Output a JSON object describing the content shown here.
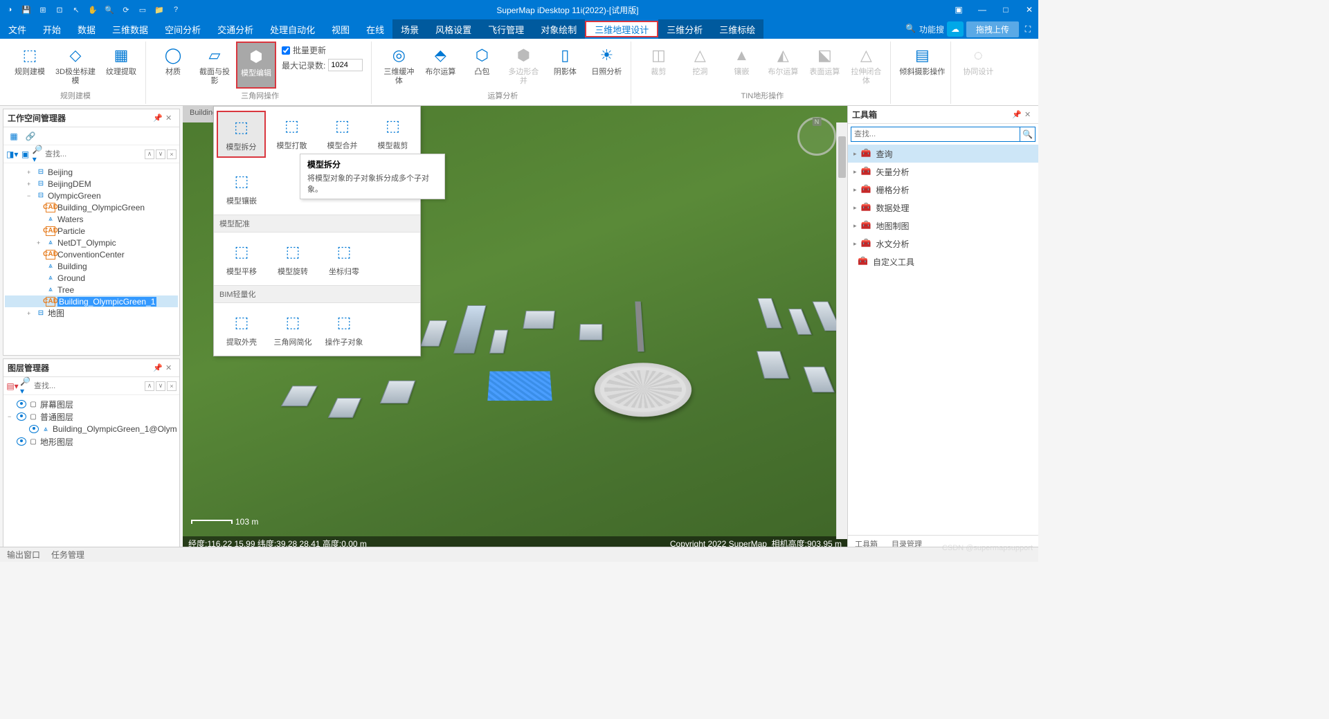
{
  "titlebar": {
    "title": "SuperMap iDesktop 11i(2022)-[试用版]"
  },
  "menu": {
    "items": [
      "文件",
      "开始",
      "数据",
      "三维数据",
      "空间分析",
      "交通分析",
      "处理自动化",
      "视图",
      "在线"
    ],
    "dark_items": [
      "场景",
      "风格设置",
      "飞行管理",
      "对象绘制"
    ],
    "active": "三维地理设计",
    "dark_items2": [
      "三维分析",
      "三维标绘"
    ],
    "search_kw": "功能搜",
    "upload": "拖拽上传"
  },
  "ribbon": {
    "g1": {
      "b1": "规则建模",
      "b2": "3D极坐标建模",
      "b3": "纹理提取",
      "lbl": "规则建模"
    },
    "g2": {
      "b1": "材质",
      "b2": "截面与投影",
      "b3": "模型编辑",
      "chk": "批量更新",
      "maxrec": "最大记录数:",
      "maxval": "1024",
      "lbl": "三角网操作"
    },
    "g3": {
      "b1": "三维缓冲体",
      "b2": "布尔运算",
      "b3": "凸包",
      "b4": "多边形合并",
      "b5": "阴影体",
      "b6": "日照分析",
      "lbl": "运算分析"
    },
    "g4": {
      "b1": "裁剪",
      "b2": "挖洞",
      "b3": "镶嵌",
      "b4": "布尔运算",
      "b5": "表面运算",
      "b6": "拉伸闭合体",
      "lbl": "TIN地形操作"
    },
    "g5": {
      "b1": "倾斜摄影操作"
    },
    "g6": {
      "b1": "协同设计"
    }
  },
  "workspace": {
    "title": "工作空间管理器",
    "search": "查找...",
    "tree": [
      {
        "d": 2,
        "tw": "+",
        "ico": "ds",
        "txt": "Beijing"
      },
      {
        "d": 2,
        "tw": "+",
        "ico": "ds",
        "txt": "BeijingDEM"
      },
      {
        "d": 2,
        "tw": "−",
        "ico": "ds",
        "txt": "OlympicGreen"
      },
      {
        "d": 3,
        "ico": "cad",
        "txt": "Building_OlympicGreen"
      },
      {
        "d": 3,
        "ico": "ln",
        "txt": "Waters"
      },
      {
        "d": 3,
        "ico": "cad",
        "txt": "Particle"
      },
      {
        "d": 3,
        "tw": "+",
        "ico": "ln",
        "txt": "NetDT_Olympic"
      },
      {
        "d": 3,
        "ico": "cad",
        "txt": "ConventionCenter"
      },
      {
        "d": 3,
        "ico": "ln",
        "txt": "Building"
      },
      {
        "d": 3,
        "ico": "ln",
        "txt": "Ground"
      },
      {
        "d": 3,
        "ico": "ln",
        "txt": "Tree"
      },
      {
        "d": 3,
        "ico": "cad",
        "txt": "Building_OlympicGreen_1",
        "sel": true
      },
      {
        "d": 2,
        "tw": "+",
        "ico": "ds",
        "txt": "地图"
      }
    ]
  },
  "layers": {
    "title": "图层管理器",
    "search": "查找...",
    "tree": [
      {
        "d": 0,
        "eye": true,
        "txt": "屏幕图层"
      },
      {
        "d": 0,
        "eye": true,
        "tw": "−",
        "txt": "普通图层"
      },
      {
        "d": 1,
        "eye": true,
        "ico": "ln",
        "txt": "Building_OlympicGreen_1@Olym"
      },
      {
        "d": 0,
        "eye": true,
        "txt": "地形图层"
      }
    ]
  },
  "dropdown": {
    "r1": [
      {
        "l": "模型拆分",
        "hl": true
      },
      {
        "l": "模型打散"
      },
      {
        "l": "模型合并"
      },
      {
        "l": "模型裁剪"
      }
    ],
    "r2": [
      {
        "l": "模型镶嵌"
      }
    ],
    "h2": "模型配准",
    "r3": [
      {
        "l": "模型平移"
      },
      {
        "l": "模型旋转"
      },
      {
        "l": "坐标归零"
      }
    ],
    "h3": "BIM轻量化",
    "r4": [
      {
        "l": "提取外壳"
      },
      {
        "l": "三角网简化"
      },
      {
        "l": "操作子对象"
      }
    ]
  },
  "tooltip": {
    "title": "模型拆分",
    "body": "将模型对象的子对象拆分成多个子对象。"
  },
  "tab": {
    "name": "Building_"
  },
  "viewport": {
    "scale": "103 m",
    "coords_left": "经度:116.22  15.99  纬度:39.28  28.41  高度:0.00 m",
    "coords_right": "相机高度:903.95 m",
    "copyright": "Copyright 2022 SuperMap"
  },
  "toolbox": {
    "title": "工具箱",
    "search": "查找...",
    "items": [
      {
        "l": "查询",
        "active": true
      },
      {
        "l": "矢量分析"
      },
      {
        "l": "栅格分析"
      },
      {
        "l": "数据处理"
      },
      {
        "l": "地图制图"
      },
      {
        "l": "水文分析"
      },
      {
        "l": "自定义工具",
        "leaf": true
      }
    ],
    "tabs": [
      "工具箱",
      "目录管理"
    ]
  },
  "status": {
    "a": "输出窗口",
    "b": "任务管理"
  },
  "watermark": "CSDN @supermapsupport"
}
